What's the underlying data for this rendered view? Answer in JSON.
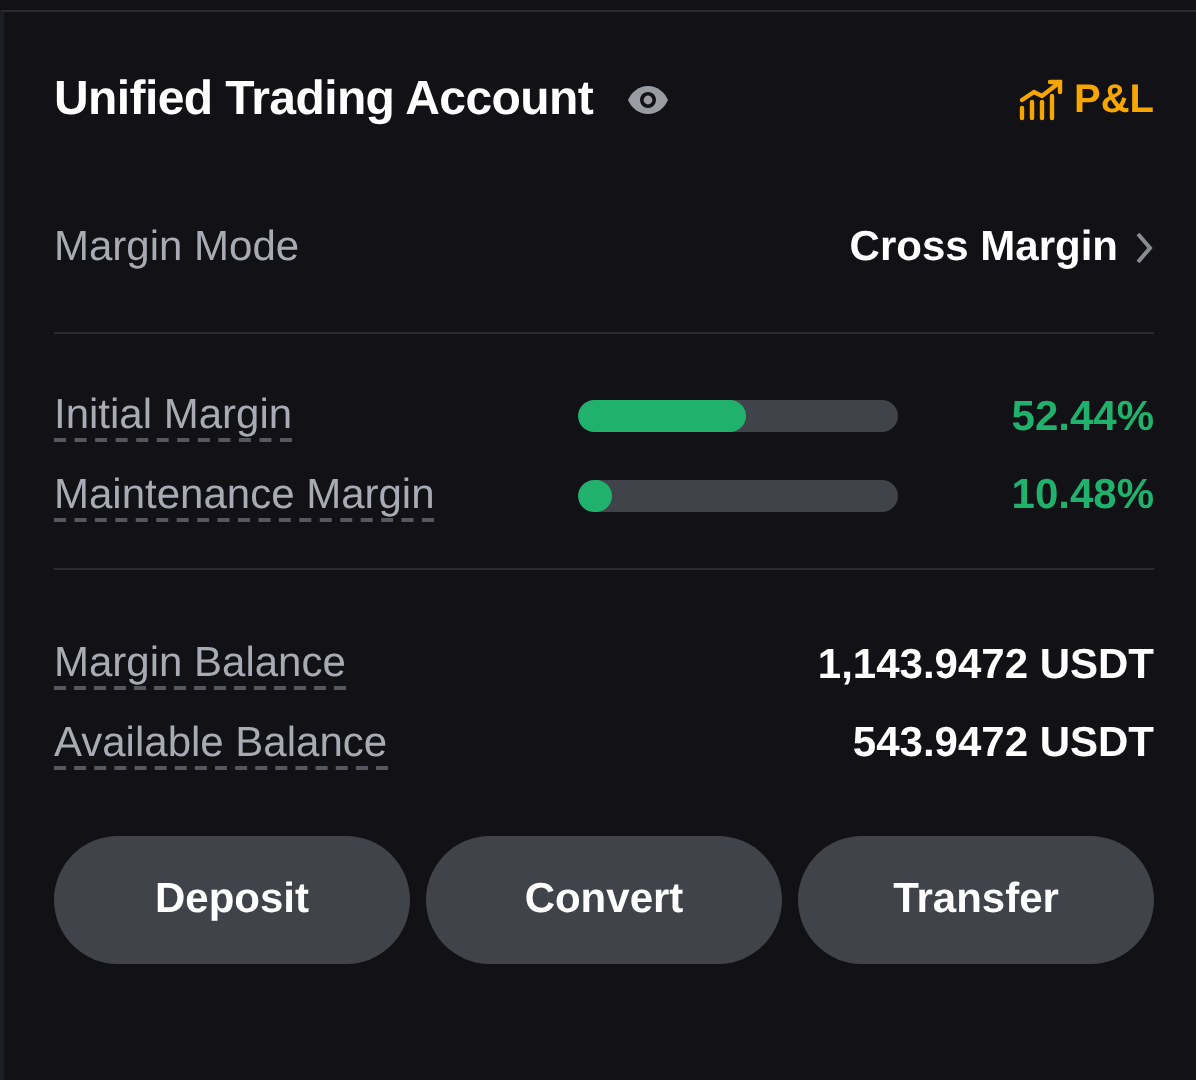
{
  "header": {
    "title": "Unified Trading Account",
    "pnl_label": "P&L"
  },
  "margin_mode": {
    "label": "Margin Mode",
    "value": "Cross Margin"
  },
  "margins": [
    {
      "label": "Initial Margin",
      "level": 0.5244,
      "reading": "52.44%"
    },
    {
      "label": "Maintenance Margin",
      "level": 0.1048,
      "reading": "10.48%"
    }
  ],
  "balances": [
    {
      "label": "Margin Balance",
      "value": "1,143.9472 USDT"
    },
    {
      "label": "Available Balance",
      "value": "543.9472 USDT"
    }
  ],
  "buttons": [
    "Deposit",
    "Convert",
    "Transfer"
  ]
}
